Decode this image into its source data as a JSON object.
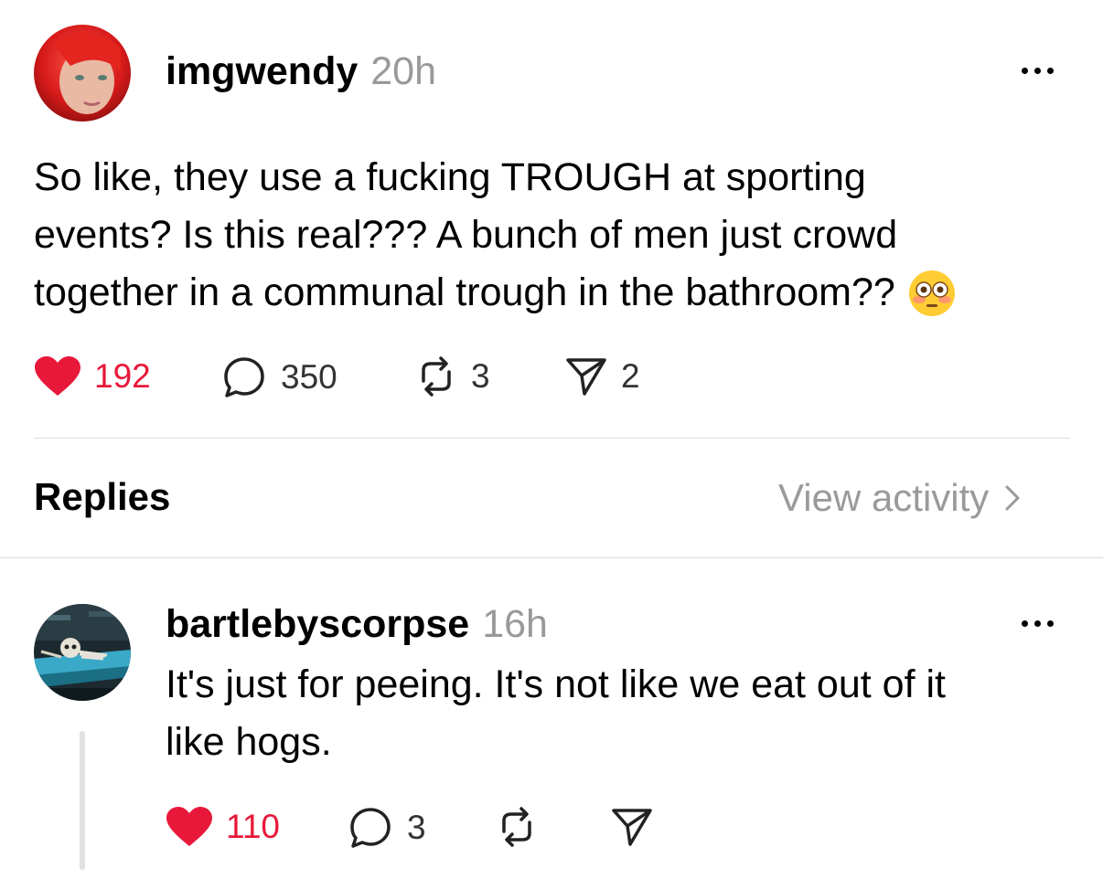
{
  "post": {
    "username": "imgwendy",
    "time": "20h",
    "text_lines": [
      "So like, they use a fucking TROUGH at sporting",
      "events? Is this real??? A bunch of men just crowd",
      "together in a communal trough in the bathroom??"
    ],
    "emoji": "flushed-face",
    "likes": "192",
    "comments": "350",
    "reposts": "3",
    "shares": "2"
  },
  "replies_header": {
    "title": "Replies",
    "view_activity": "View activity"
  },
  "reply": {
    "username": "bartlebyscorpse",
    "time": "16h",
    "text_lines": [
      "It's just for peeing. It's not like we eat out of it",
      "like hogs."
    ],
    "likes": "110",
    "comments": "3"
  },
  "colors": {
    "like": "#e8183a",
    "muted": "#999999",
    "divider": "#dcdcdc"
  }
}
